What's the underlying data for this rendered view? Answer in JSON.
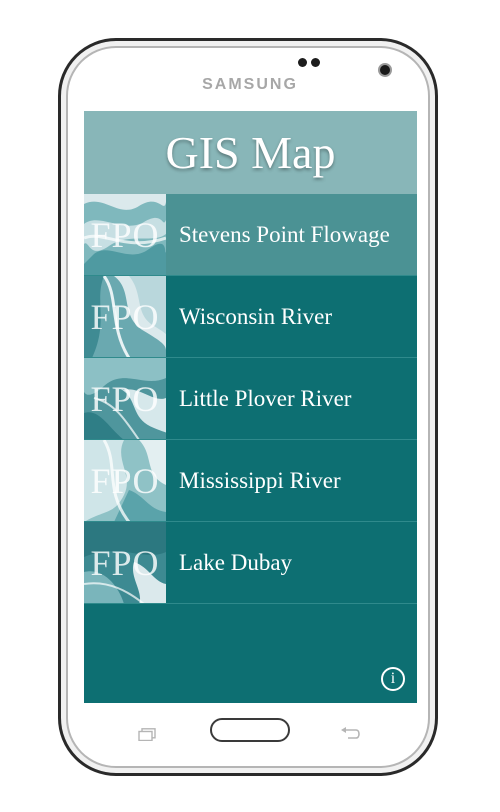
{
  "device": {
    "brand": "SAMSUNG"
  },
  "app": {
    "title": "GIS Map"
  },
  "locations": [
    {
      "thumb_text": "FPO",
      "name": "Stevens Point Flowage",
      "active": true
    },
    {
      "thumb_text": "FPO",
      "name": "Wisconsin River",
      "active": false
    },
    {
      "thumb_text": "FPO",
      "name": "Little Plover River",
      "active": false
    },
    {
      "thumb_text": "FPO",
      "name": "Mississippi River",
      "active": false
    },
    {
      "thumb_text": "FPO",
      "name": "Lake Dubay",
      "active": false
    }
  ],
  "info_button": {
    "glyph": "i",
    "icon": "info-icon"
  },
  "colors": {
    "screen_bg": "#0d6f72",
    "header_bg": "#88b6b8",
    "active_row": "#4b9294"
  }
}
